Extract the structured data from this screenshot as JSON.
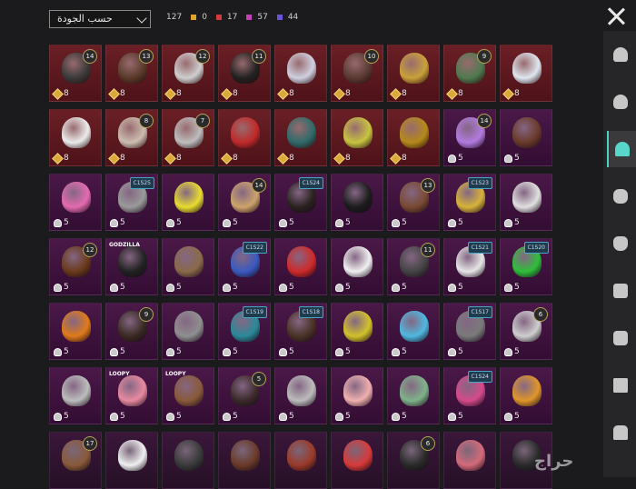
{
  "sort": {
    "label": "حسب الجودة"
  },
  "counts": {
    "total": "127",
    "items": [
      {
        "color": "#e0a22c",
        "value": "0"
      },
      {
        "color": "#d23b3b",
        "value": "17"
      },
      {
        "color": "#c33fb5",
        "value": "57"
      },
      {
        "color": "#6a53d6",
        "value": "44"
      }
    ]
  },
  "watermark": "حراج",
  "sidebar": [
    "hat-icon",
    "helmet-icon",
    "cap-icon",
    "glasses-icon",
    "mask-icon",
    "jacket-icon",
    "backpack-icon",
    "pants-icon",
    "shoes-icon"
  ],
  "items": [
    {
      "bg": "red",
      "val": "8",
      "lvl": "14",
      "c": "#3a3a3a"
    },
    {
      "bg": "red",
      "val": "8",
      "lvl": "13",
      "c": "#5a3a2a"
    },
    {
      "bg": "red",
      "val": "8",
      "lvl": "12",
      "c": "#cfcfcf"
    },
    {
      "bg": "red",
      "val": "8",
      "lvl": "11",
      "c": "#222222"
    },
    {
      "bg": "red",
      "val": "8",
      "lvl": "",
      "c": "#d0d0e0"
    },
    {
      "bg": "red",
      "val": "8",
      "lvl": "10",
      "c": "#5a3a32"
    },
    {
      "bg": "red",
      "val": "8",
      "lvl": "",
      "c": "#c9a13a"
    },
    {
      "bg": "red",
      "val": "8",
      "lvl": "9",
      "c": "#4f7a4f"
    },
    {
      "bg": "red",
      "val": "8",
      "lvl": "",
      "c": "#dfe6ee"
    },
    {
      "bg": "red",
      "val": "8",
      "lvl": "",
      "c": "#ececec"
    },
    {
      "bg": "red",
      "val": "8",
      "lvl": "8",
      "c": "#cdbdb0"
    },
    {
      "bg": "red",
      "val": "8",
      "lvl": "7",
      "c": "#bdbdbd"
    },
    {
      "bg": "red",
      "val": "8",
      "lvl": "",
      "c": "#c02a2a"
    },
    {
      "bg": "red",
      "val": "8",
      "lvl": "",
      "c": "#2f6a6a"
    },
    {
      "bg": "red",
      "val": "8",
      "lvl": "",
      "c": "#c8c440"
    },
    {
      "bg": "red",
      "val": "8",
      "lvl": "",
      "c": "#b58a1a"
    },
    {
      "bg": "purple",
      "val": "5",
      "lvl": "14",
      "c": "#b37be0"
    },
    {
      "bg": "purple",
      "val": "5",
      "lvl": "",
      "c": "#6a3a2a"
    },
    {
      "bg": "purple",
      "val": "5",
      "lvl": "",
      "c": "#e46bb0"
    },
    {
      "bg": "purple",
      "val": "5",
      "lvl": "",
      "tag": "C1S25",
      "c": "#9a9a9a"
    },
    {
      "bg": "purple",
      "val": "5",
      "lvl": "",
      "c": "#e8dc30"
    },
    {
      "bg": "purple",
      "val": "5",
      "lvl": "14",
      "c": "#cda36a"
    },
    {
      "bg": "purple",
      "val": "5",
      "lvl": "",
      "tag": "C1S24",
      "c": "#2a2220"
    },
    {
      "bg": "purple",
      "val": "5",
      "lvl": "",
      "c": "#1c1c1c"
    },
    {
      "bg": "purple",
      "val": "5",
      "lvl": "13",
      "c": "#7a4a32"
    },
    {
      "bg": "purple",
      "val": "5",
      "lvl": "",
      "tag": "C1S23",
      "c": "#d7b33a"
    },
    {
      "bg": "purple",
      "val": "5",
      "lvl": "",
      "c": "#e0e0e0"
    },
    {
      "bg": "purple",
      "val": "5",
      "lvl": "12",
      "c": "#6a3a1a"
    },
    {
      "bg": "purple",
      "val": "5",
      "lvl": "",
      "badge": "GODZILLA",
      "c": "#222222"
    },
    {
      "bg": "purple",
      "val": "5",
      "lvl": "",
      "c": "#8a6a4a"
    },
    {
      "bg": "purple",
      "val": "5",
      "lvl": "",
      "tag": "C1S22",
      "c": "#3a5ac0"
    },
    {
      "bg": "purple",
      "val": "5",
      "lvl": "",
      "c": "#d02a2a"
    },
    {
      "bg": "purple",
      "val": "5",
      "lvl": "",
      "c": "#f0f0f0"
    },
    {
      "bg": "purple",
      "val": "5",
      "lvl": "11",
      "c": "#444444"
    },
    {
      "bg": "purple",
      "val": "5",
      "lvl": "",
      "tag": "C1S21",
      "c": "#e6e6e6"
    },
    {
      "bg": "purple",
      "val": "5",
      "lvl": "",
      "tag": "C1S20",
      "c": "#2fbf3a"
    },
    {
      "bg": "purple",
      "val": "5",
      "lvl": "",
      "c": "#e07a1a"
    },
    {
      "bg": "purple",
      "val": "5",
      "lvl": "9",
      "c": "#3a2a22"
    },
    {
      "bg": "purple",
      "val": "5",
      "lvl": "",
      "c": "#8f8f8f"
    },
    {
      "bg": "purple",
      "val": "5",
      "lvl": "",
      "tag": "C1S19",
      "c": "#2a8a9a"
    },
    {
      "bg": "purple",
      "val": "5",
      "lvl": "",
      "tag": "C1S18",
      "c": "#4a3326"
    },
    {
      "bg": "purple",
      "val": "5",
      "lvl": "",
      "c": "#d2c22a"
    },
    {
      "bg": "purple",
      "val": "5",
      "lvl": "",
      "c": "#4fb8e0"
    },
    {
      "bg": "purple",
      "val": "5",
      "lvl": "",
      "tag": "C1S17",
      "c": "#7a7a7a"
    },
    {
      "bg": "purple",
      "val": "5",
      "lvl": "6",
      "c": "#cfcfcf"
    },
    {
      "bg": "purple",
      "val": "5",
      "lvl": "",
      "c": "#bdbdbd"
    },
    {
      "bg": "purple",
      "val": "5",
      "lvl": "",
      "badge": "LOOPY",
      "c": "#e88aa0"
    },
    {
      "bg": "purple",
      "val": "5",
      "lvl": "",
      "badge": "LOOPY",
      "c": "#8a5a3a"
    },
    {
      "bg": "purple",
      "val": "5",
      "lvl": "5",
      "c": "#3a2a2a"
    },
    {
      "bg": "purple",
      "val": "5",
      "lvl": "",
      "c": "#bcbcbc"
    },
    {
      "bg": "purple",
      "val": "5",
      "lvl": "",
      "c": "#f0b0b0"
    },
    {
      "bg": "purple",
      "val": "5",
      "lvl": "",
      "c": "#7fb38a"
    },
    {
      "bg": "purple",
      "val": "5",
      "lvl": "",
      "tag": "C1S24",
      "c": "#d44a8a"
    },
    {
      "bg": "purple",
      "val": "5",
      "lvl": "",
      "c": "#e0962a"
    },
    {
      "bg": "dark",
      "val": "",
      "lvl": "17",
      "c": "#8a5a3a"
    },
    {
      "bg": "dark",
      "val": "",
      "lvl": "",
      "c": "#f0f0f0"
    },
    {
      "bg": "dark",
      "val": "",
      "lvl": "",
      "c": "#3a3a3a"
    },
    {
      "bg": "dark",
      "val": "",
      "lvl": "",
      "c": "#6a3a2a"
    },
    {
      "bg": "dark",
      "val": "",
      "lvl": "",
      "c": "#9a3a2a"
    },
    {
      "bg": "dark",
      "val": "",
      "lvl": "",
      "c": "#d83a3a"
    },
    {
      "bg": "dark",
      "val": "",
      "lvl": "6",
      "c": "#2a2a2a"
    },
    {
      "bg": "dark",
      "val": "",
      "lvl": "",
      "c": "#d36a7a"
    },
    {
      "bg": "dark",
      "val": "",
      "lvl": "",
      "c": "#2a2a2a"
    }
  ]
}
